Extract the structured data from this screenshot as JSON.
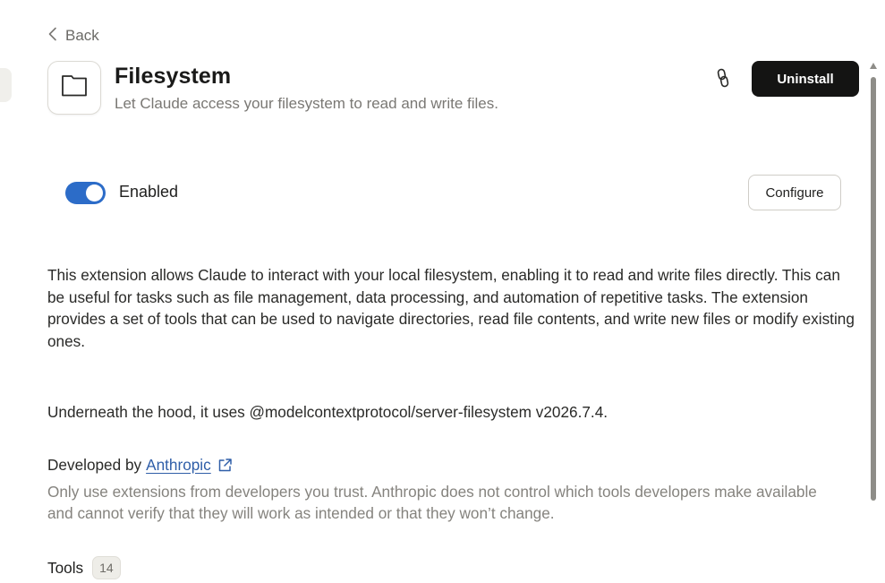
{
  "nav": {
    "back_label": "Back"
  },
  "extension": {
    "title": "Filesystem",
    "subtitle": "Let Claude access your filesystem to read and write files.",
    "icon": "folder-icon"
  },
  "actions": {
    "uninstall_label": "Uninstall",
    "configure_label": "Configure",
    "link_icon": "link-icon"
  },
  "status": {
    "enabled_label": "Enabled",
    "enabled": true
  },
  "description": "This extension allows Claude to interact with your local filesystem, enabling it to read and write files directly. This can be useful for tasks such as file management, data processing, and automation of repetitive tasks. The extension provides a set of tools that can be used to navigate directories, read file contents, and write new files or modify existing ones.",
  "hood_text": "Underneath the hood, it uses @modelcontextprotocol/server-filesystem v2026.7.4.",
  "developer": {
    "prefix": "Developed by",
    "name": "Anthropic",
    "warning": "Only use extensions from developers you trust. Anthropic does not control which tools developers make available and cannot verify that they will work as intended or that they won’t change."
  },
  "tools": {
    "label": "Tools",
    "count": "14"
  },
  "colors": {
    "toggle_on": "#2c6cc8",
    "primary_button": "#141413",
    "link": "#2f5ea8",
    "muted_text": "#85837e"
  }
}
